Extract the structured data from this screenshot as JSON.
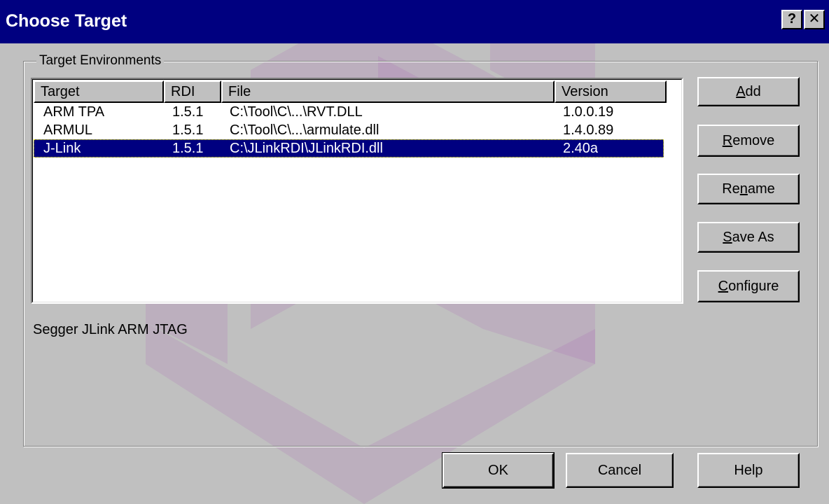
{
  "window": {
    "title": "Choose Target",
    "help_glyph": "?",
    "close_glyph": "✕"
  },
  "group": {
    "label": "Target Environments"
  },
  "list": {
    "columns": [
      "Target",
      "RDI",
      "File",
      "Version"
    ],
    "rows": [
      {
        "target": "ARM TPA",
        "rdi": "1.5.1",
        "file": "C:\\Tool\\C\\...\\RVT.DLL",
        "version": "1.0.0.19",
        "selected": false
      },
      {
        "target": "ARMUL",
        "rdi": "1.5.1",
        "file": "C:\\Tool\\C\\...\\armulate.dll",
        "version": "1.4.0.89",
        "selected": false
      },
      {
        "target": "J-Link",
        "rdi": "1.5.1",
        "file": "C:\\JLinkRDI\\JLinkRDI.dll",
        "version": "2.40a",
        "selected": true
      }
    ]
  },
  "description": "Segger JLink ARM JTAG",
  "side_buttons": {
    "add": {
      "pre": "",
      "mnemonic": "A",
      "post": "dd"
    },
    "remove": {
      "pre": "",
      "mnemonic": "R",
      "post": "emove"
    },
    "rename": {
      "pre": "Re",
      "mnemonic": "n",
      "post": "ame"
    },
    "save_as": {
      "pre": "",
      "mnemonic": "S",
      "post": "ave As"
    },
    "configure": {
      "pre": "",
      "mnemonic": "C",
      "post": "onfigure"
    }
  },
  "bottom_buttons": {
    "ok": "OK",
    "cancel": "Cancel",
    "help": "Help"
  },
  "colors": {
    "title_bar": "#000080",
    "face": "#c0c0c0",
    "selection": "#000080",
    "watermark": "#8a2a9a"
  }
}
